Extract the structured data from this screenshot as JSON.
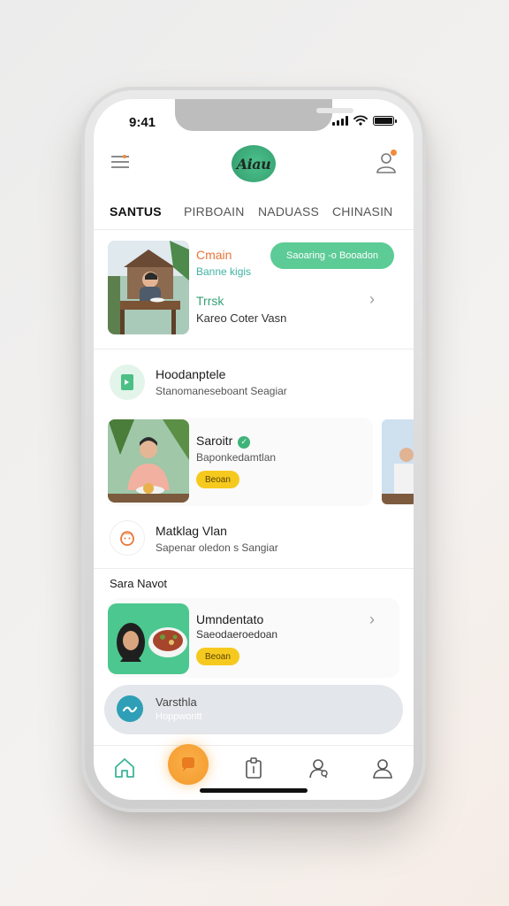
{
  "status_bar": {
    "time": "9:41"
  },
  "header": {
    "logo_text": "Aiau"
  },
  "tabs": [
    {
      "label": "SANTUS",
      "active": true
    },
    {
      "label": "PIRBOAIN",
      "active": false
    },
    {
      "label": "NADUASS",
      "active": false
    },
    {
      "label": "CHINASIN",
      "active": false
    }
  ],
  "feed": {
    "card1": {
      "line1": "Cmain",
      "line2": "Banne kigis",
      "pill": "Saoaring -o Booadon",
      "line3": "Trrsk",
      "line4": "Kareo Coter Vasn"
    },
    "row1": {
      "title": "Hoodanptele",
      "subtitle": "Stanomaneseboant Seagiar"
    },
    "card2": {
      "title": "Saroitr",
      "subtitle": "Baponkedamtlan",
      "badge": "Beoan"
    },
    "row2": {
      "title": "Matklag Vlan",
      "subtitle": "Sapenar oledon s Sangiar"
    },
    "section_title": "Sara Navot",
    "card3": {
      "title": "Umndentato",
      "subtitle": "Saeodaeroedoan",
      "badge": "Beoan"
    },
    "pill_bar": {
      "title": "Varsthla",
      "subtitle": "Hoppwontt"
    }
  },
  "colors": {
    "accent_green": "#5ccb96",
    "accent_orange": "#f39a2b",
    "badge_yellow": "#f6c91f",
    "teal": "#3fb3a3"
  }
}
